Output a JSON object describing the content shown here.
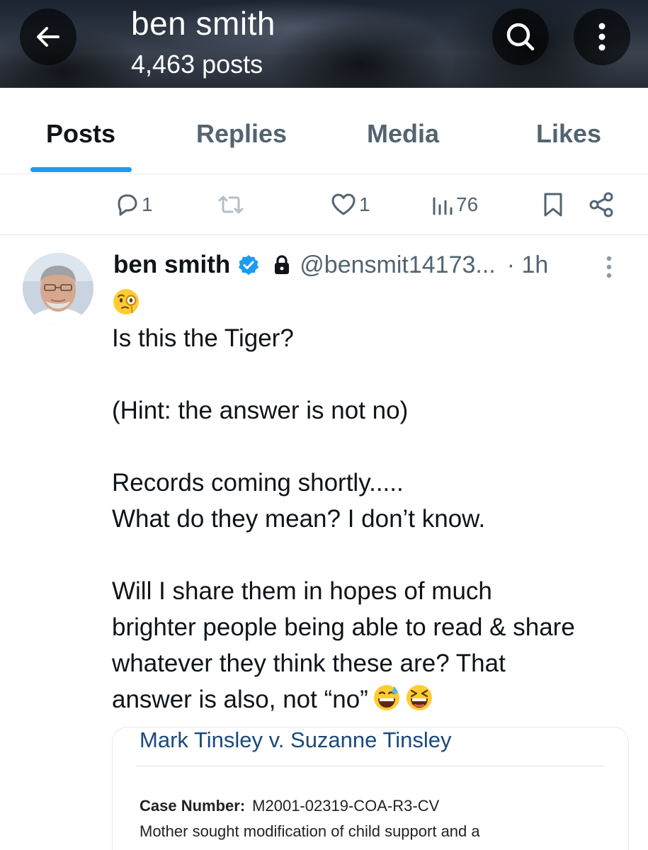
{
  "header": {
    "title": "ben smith",
    "subtitle": "4,463 posts",
    "back_icon": "arrow-left-icon",
    "search_icon": "search-icon",
    "more_icon": "more-vertical-icon"
  },
  "tabs": [
    {
      "label": "Posts",
      "active": true
    },
    {
      "label": "Replies",
      "active": false
    },
    {
      "label": "Media",
      "active": false
    },
    {
      "label": "Likes",
      "active": false
    }
  ],
  "previous_post_actions": {
    "replies": "1",
    "reposts": "",
    "likes": "1",
    "views": "76"
  },
  "post": {
    "author_name": "ben smith",
    "verified": true,
    "protected": true,
    "handle": "@bensmit14173...",
    "time": "· 1h",
    "lead_emoji": "face-with-monocle",
    "lines": [
      "Is this the Tiger?",
      "",
      "(Hint: the answer is not no)",
      "",
      "Records coming shortly.....",
      "What do they mean? I don’t know.",
      "",
      "Will I share them in hopes of much",
      "brighter people being able to read & share",
      "whatever they think these are? That",
      "answer is also, not “no”"
    ],
    "trailing_emojis": [
      "grinning-face-with-sweat",
      "grinning-squinting-face"
    ]
  },
  "card": {
    "title": "Mark Tinsley v. Suzanne Tinsley",
    "case_label": "Case Number:",
    "case_value": "M2001-02319-COA-R3-CV",
    "body": "Mother sought modification of child support and a"
  },
  "colors": {
    "accent": "#1d9bf0",
    "secondary_text": "#536471",
    "primary_text": "#0f1419",
    "card_title": "#1a4a7a"
  }
}
